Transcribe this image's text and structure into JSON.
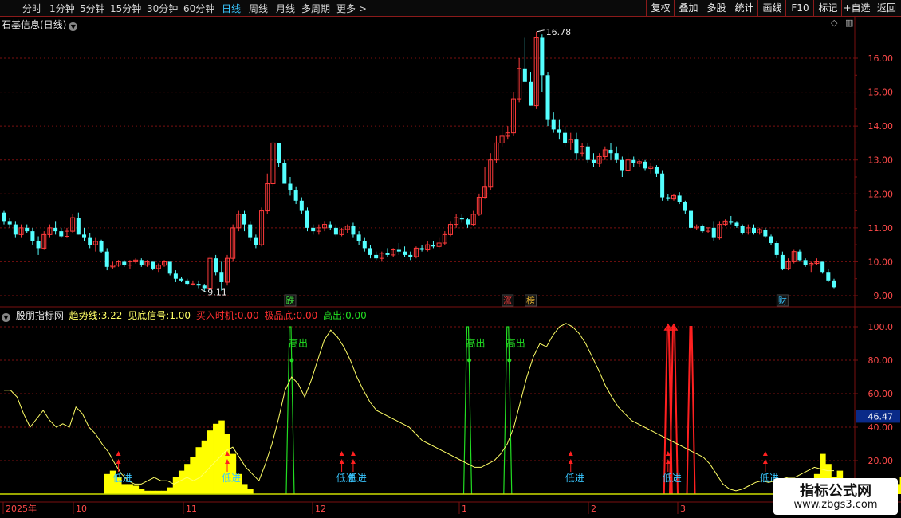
{
  "toolbar": {
    "periods": [
      "分时",
      "1分钟",
      "5分钟",
      "15分钟",
      "30分钟",
      "60分钟",
      "日线",
      "周线",
      "月线",
      "多周期",
      "更多 >"
    ],
    "active_period": "日线",
    "buttons": [
      "复权",
      "叠加",
      "多股",
      "统计",
      "画线",
      "F10",
      "标记",
      "+自选",
      "返回"
    ]
  },
  "main": {
    "title": "石基信息(日线)",
    "y_ticks": [
      "16.00",
      "15.00",
      "14.00",
      "13.00",
      "12.00",
      "11.00",
      "10.00",
      "9.00"
    ],
    "high_label": "16.78",
    "low_label": "9.11",
    "events": [
      {
        "text": "跌",
        "color": "#3cd63c"
      },
      {
        "text": "涨",
        "color": "#ff4040"
      },
      {
        "text": "榜",
        "color": "#e0b030"
      },
      {
        "text": "财",
        "color": "#39c6ff"
      }
    ]
  },
  "indicator": {
    "name": "股朋指标网",
    "trend_label": "趋势线:",
    "trend_value": "3.22",
    "bottom_label": "见底信号:",
    "bottom_value": "1.00",
    "buy_label": "买入时机:",
    "buy_value": "0.00",
    "extreme_label": "极品底:",
    "extreme_value": "0.00",
    "high_out_label": "高出:",
    "high_out_value": "0.00",
    "y_ticks": [
      "100.0",
      "80.00",
      "60.00",
      "40.00",
      "20.00"
    ],
    "current_value": "46.47",
    "low_in_text": "低进",
    "high_out_text": "高出"
  },
  "x_axis": {
    "labels": [
      "2025年",
      "10",
      "11",
      "12",
      "1",
      "2",
      "3"
    ]
  },
  "watermark": {
    "title": "指标公式网",
    "url": "www.zbgs3.com"
  },
  "colors": {
    "up": "#ff3b3b",
    "down": "#54ffff",
    "grid": "#7a1010",
    "trend": "#ffff66",
    "bars": "#ffff00",
    "green": "#22dd22",
    "red": "#ff2020",
    "signal": "#39c6ff"
  },
  "chart_data": {
    "type": "candlestick",
    "y_range": [
      8.8,
      16.9
    ],
    "candles": [
      [
        11.45,
        11.5,
        11.1,
        11.2
      ],
      [
        11.2,
        11.3,
        11.0,
        11.1
      ],
      [
        11.1,
        11.2,
        10.7,
        10.8
      ],
      [
        10.8,
        11.1,
        10.7,
        11.0
      ],
      [
        11.0,
        11.1,
        10.85,
        10.9
      ],
      [
        10.9,
        11.0,
        10.5,
        10.6
      ],
      [
        10.6,
        10.75,
        10.2,
        10.4
      ],
      [
        10.4,
        10.9,
        10.35,
        10.8
      ],
      [
        10.8,
        11.1,
        10.7,
        11.0
      ],
      [
        11.0,
        11.2,
        10.8,
        10.9
      ],
      [
        10.9,
        11.0,
        10.7,
        10.75
      ],
      [
        10.75,
        11.0,
        10.7,
        10.9
      ],
      [
        10.9,
        11.4,
        10.85,
        11.3
      ],
      [
        11.3,
        11.45,
        10.8,
        10.8
      ],
      [
        10.8,
        11.0,
        10.6,
        10.7
      ],
      [
        10.7,
        10.85,
        10.4,
        10.5
      ],
      [
        10.5,
        10.7,
        10.3,
        10.6
      ],
      [
        10.6,
        10.65,
        10.25,
        10.3
      ],
      [
        10.3,
        10.4,
        9.75,
        9.85
      ],
      [
        9.85,
        10.0,
        9.8,
        9.9
      ],
      [
        9.9,
        10.05,
        9.85,
        10.0
      ],
      [
        10.0,
        10.05,
        9.85,
        9.9
      ],
      [
        9.9,
        10.05,
        9.8,
        10.0
      ],
      [
        10.0,
        10.1,
        9.95,
        10.05
      ],
      [
        10.05,
        10.1,
        9.85,
        9.9
      ],
      [
        9.9,
        10.05,
        9.85,
        10.0
      ],
      [
        10.0,
        10.0,
        9.75,
        9.8
      ],
      [
        9.8,
        9.95,
        9.7,
        9.9
      ],
      [
        9.9,
        10.05,
        9.85,
        10.0
      ],
      [
        10.0,
        10.0,
        9.6,
        9.65
      ],
      [
        9.65,
        9.75,
        9.4,
        9.5
      ],
      [
        9.5,
        9.55,
        9.4,
        9.45
      ],
      [
        9.45,
        9.5,
        9.3,
        9.35
      ],
      [
        9.35,
        9.45,
        9.3,
        9.35
      ],
      [
        9.35,
        9.45,
        9.2,
        9.3
      ],
      [
        9.3,
        9.35,
        9.11,
        9.2
      ],
      [
        9.2,
        10.2,
        9.15,
        10.1
      ],
      [
        10.1,
        10.2,
        9.6,
        9.7
      ],
      [
        9.7,
        10.0,
        9.15,
        9.4
      ],
      [
        9.4,
        10.2,
        9.3,
        10.1
      ],
      [
        10.1,
        11.1,
        10.0,
        11.0
      ],
      [
        11.0,
        11.5,
        10.9,
        11.4
      ],
      [
        11.4,
        11.5,
        10.9,
        11.1
      ],
      [
        11.1,
        11.2,
        10.6,
        10.7
      ],
      [
        10.7,
        10.8,
        10.4,
        10.5
      ],
      [
        10.5,
        11.6,
        10.45,
        11.5
      ],
      [
        11.5,
        12.6,
        11.4,
        12.3
      ],
      [
        12.3,
        13.5,
        12.2,
        13.5
      ],
      [
        13.5,
        13.5,
        12.8,
        12.9
      ],
      [
        12.9,
        13.0,
        12.4,
        12.3
      ],
      [
        12.3,
        12.5,
        11.95,
        12.1
      ],
      [
        12.1,
        12.2,
        11.7,
        11.8
      ],
      [
        11.8,
        11.9,
        11.4,
        11.5
      ],
      [
        11.5,
        11.6,
        10.9,
        11.0
      ],
      [
        11.0,
        11.1,
        10.8,
        10.9
      ],
      [
        10.9,
        11.1,
        10.8,
        11.0
      ],
      [
        11.0,
        11.2,
        10.9,
        11.1
      ],
      [
        11.1,
        11.2,
        10.95,
        11.0
      ],
      [
        11.0,
        11.1,
        10.75,
        10.8
      ],
      [
        10.8,
        11.0,
        10.75,
        10.95
      ],
      [
        10.95,
        11.1,
        10.85,
        11.05
      ],
      [
        11.05,
        11.15,
        10.7,
        10.8
      ],
      [
        10.8,
        10.9,
        10.5,
        10.6
      ],
      [
        10.6,
        10.7,
        10.3,
        10.4
      ],
      [
        10.4,
        10.5,
        10.1,
        10.2
      ],
      [
        10.2,
        10.3,
        10.05,
        10.1
      ],
      [
        10.1,
        10.3,
        10.0,
        10.25
      ],
      [
        10.25,
        10.4,
        10.15,
        10.2
      ],
      [
        10.2,
        10.4,
        10.15,
        10.35
      ],
      [
        10.35,
        10.55,
        10.2,
        10.3
      ],
      [
        10.3,
        10.45,
        10.15,
        10.2
      ],
      [
        10.2,
        10.3,
        10.05,
        10.15
      ],
      [
        10.15,
        10.45,
        10.1,
        10.4
      ],
      [
        10.4,
        10.5,
        10.3,
        10.35
      ],
      [
        10.35,
        10.6,
        10.3,
        10.5
      ],
      [
        10.5,
        10.6,
        10.4,
        10.45
      ],
      [
        10.45,
        10.7,
        10.4,
        10.55
      ],
      [
        10.55,
        10.9,
        10.5,
        10.8
      ],
      [
        10.8,
        11.2,
        10.75,
        11.1
      ],
      [
        11.1,
        11.4,
        11.0,
        11.3
      ],
      [
        11.3,
        11.4,
        11.15,
        11.25
      ],
      [
        11.25,
        11.3,
        11.0,
        11.1
      ],
      [
        11.1,
        11.5,
        11.05,
        11.4
      ],
      [
        11.4,
        12.0,
        11.35,
        11.9
      ],
      [
        11.9,
        12.8,
        11.85,
        12.2
      ],
      [
        12.2,
        13.2,
        12.1,
        13.0
      ],
      [
        13.0,
        13.7,
        12.9,
        13.5
      ],
      [
        13.5,
        14.0,
        13.4,
        13.7
      ],
      [
        13.7,
        14.0,
        13.6,
        13.8
      ],
      [
        13.8,
        15.0,
        13.7,
        14.8
      ],
      [
        14.8,
        16.0,
        14.7,
        15.7
      ],
      [
        15.7,
        16.6,
        15.5,
        15.3
      ],
      [
        15.3,
        15.6,
        14.6,
        14.6
      ],
      [
        14.6,
        16.78,
        14.5,
        16.6
      ],
      [
        16.6,
        16.7,
        15.0,
        15.5
      ],
      [
        15.5,
        15.6,
        14.0,
        14.2
      ],
      [
        14.2,
        14.4,
        13.8,
        13.9
      ],
      [
        13.9,
        14.2,
        13.6,
        13.8
      ],
      [
        13.8,
        14.0,
        13.4,
        13.5
      ],
      [
        13.5,
        13.8,
        13.3,
        13.6
      ],
      [
        13.6,
        13.8,
        13.0,
        13.2
      ],
      [
        13.2,
        13.5,
        13.1,
        13.4
      ],
      [
        13.4,
        13.5,
        12.9,
        13.0
      ],
      [
        13.0,
        13.2,
        12.8,
        12.9
      ],
      [
        12.9,
        13.2,
        12.8,
        13.1
      ],
      [
        13.1,
        13.4,
        13.0,
        13.3
      ],
      [
        13.3,
        13.5,
        13.0,
        13.2
      ],
      [
        13.2,
        13.4,
        12.9,
        13.0
      ],
      [
        13.0,
        13.1,
        12.5,
        12.7
      ],
      [
        12.7,
        13.2,
        12.6,
        13.0
      ],
      [
        13.0,
        13.1,
        12.8,
        12.9
      ],
      [
        12.9,
        13.0,
        12.8,
        12.95
      ],
      [
        12.95,
        13.0,
        12.7,
        12.75
      ],
      [
        12.75,
        12.9,
        12.6,
        12.8
      ],
      [
        12.8,
        12.85,
        12.5,
        12.6
      ],
      [
        12.6,
        12.7,
        11.8,
        11.9
      ],
      [
        11.9,
        12.0,
        11.8,
        11.85
      ],
      [
        11.85,
        12.0,
        11.8,
        11.95
      ],
      [
        11.95,
        12.05,
        11.7,
        11.75
      ],
      [
        11.75,
        11.8,
        11.4,
        11.5
      ],
      [
        11.5,
        11.55,
        10.9,
        11.0
      ],
      [
        11.0,
        11.1,
        10.95,
        11.05
      ],
      [
        11.05,
        11.1,
        10.85,
        10.9
      ],
      [
        10.9,
        11.0,
        10.85,
        11.0
      ],
      [
        11.0,
        11.2,
        10.6,
        10.7
      ],
      [
        10.7,
        11.2,
        10.65,
        11.1
      ],
      [
        11.1,
        11.25,
        11.05,
        11.2
      ],
      [
        11.2,
        11.35,
        11.1,
        11.15
      ],
      [
        11.15,
        11.2,
        11.0,
        11.05
      ],
      [
        11.05,
        11.1,
        10.8,
        10.85
      ],
      [
        10.85,
        11.1,
        10.8,
        11.0
      ],
      [
        11.0,
        11.1,
        10.8,
        10.85
      ],
      [
        10.85,
        11.0,
        10.8,
        10.95
      ],
      [
        10.95,
        11.0,
        10.7,
        10.75
      ],
      [
        10.75,
        10.8,
        10.5,
        10.55
      ],
      [
        10.55,
        10.6,
        10.1,
        10.2
      ],
      [
        10.2,
        10.3,
        9.75,
        9.8
      ],
      [
        9.8,
        10.1,
        9.75,
        10.0
      ],
      [
        10.0,
        10.35,
        9.95,
        10.3
      ],
      [
        10.3,
        10.35,
        10.0,
        10.05
      ],
      [
        10.05,
        10.1,
        9.85,
        9.9
      ],
      [
        9.9,
        10.0,
        9.7,
        9.95
      ],
      [
        9.95,
        10.1,
        9.9,
        10.0
      ],
      [
        10.0,
        10.0,
        9.65,
        9.7
      ],
      [
        9.7,
        9.8,
        9.4,
        9.45
      ],
      [
        9.45,
        9.5,
        9.2,
        9.25
      ]
    ],
    "indicator_trend": [
      62,
      62,
      58,
      48,
      40,
      45,
      50,
      44,
      40,
      42,
      40,
      52,
      48,
      40,
      36,
      30,
      25,
      18,
      12,
      8,
      6,
      6,
      8,
      10,
      8,
      8,
      6,
      8,
      10,
      8,
      10,
      14,
      18,
      22,
      26,
      28,
      22,
      16,
      12,
      8,
      18,
      30,
      45,
      62,
      70,
      66,
      58,
      68,
      80,
      92,
      98,
      94,
      88,
      80,
      70,
      62,
      55,
      50,
      48,
      46,
      44,
      42,
      40,
      36,
      32,
      30,
      28,
      26,
      24,
      22,
      20,
      18,
      16,
      16,
      18,
      20,
      24,
      30,
      40,
      55,
      70,
      82,
      90,
      88,
      95,
      100,
      102,
      100,
      96,
      90,
      82,
      74,
      65,
      58,
      52,
      48,
      44,
      42,
      40,
      38,
      36,
      34,
      32,
      30,
      28,
      26,
      24,
      22,
      18,
      12,
      6,
      3,
      2,
      3,
      5,
      7,
      8,
      7,
      8,
      9,
      10,
      10,
      12,
      14,
      16,
      15,
      14,
      14
    ],
    "indicator_bars": [
      0,
      0,
      0,
      0,
      0,
      0,
      0,
      0,
      0,
      0,
      0,
      0,
      0,
      0,
      0,
      0,
      0,
      0,
      12,
      14,
      10,
      6,
      6,
      5,
      3,
      2,
      2,
      2,
      2,
      4,
      10,
      14,
      18,
      22,
      28,
      32,
      38,
      42,
      44,
      36,
      24,
      12,
      6,
      3,
      0,
      0,
      0,
      0,
      0,
      0,
      0,
      0,
      0,
      0,
      0,
      0,
      0,
      0,
      0,
      0,
      0,
      0,
      0,
      0,
      0,
      0,
      0,
      0,
      0,
      0,
      0,
      0,
      0,
      0,
      0,
      0,
      0,
      0,
      0,
      0,
      0,
      0,
      0,
      0,
      0,
      0,
      0,
      0,
      0,
      0,
      0,
      0,
      0,
      0,
      0,
      0,
      0,
      0,
      0,
      0,
      0,
      0,
      0,
      0,
      0,
      0,
      0,
      0,
      0,
      0,
      0,
      0,
      0,
      0,
      0,
      0,
      0,
      0,
      0,
      0,
      0,
      0,
      0,
      0,
      0,
      0,
      0,
      0,
      0,
      0,
      0,
      0,
      0,
      0,
      0,
      0,
      0,
      0,
      0,
      0,
      0,
      0,
      12,
      24,
      18,
      10,
      14,
      6,
      8,
      4,
      2,
      0,
      0,
      0,
      4,
      0,
      6,
      10,
      12,
      18,
      8,
      10,
      14,
      16,
      8,
      12,
      20,
      18
    ],
    "low_in_idx": [
      20,
      39,
      59,
      61,
      99,
      116,
      133
    ],
    "high_out_idx": [
      50,
      81,
      88
    ],
    "green_spikes": [
      50,
      81,
      88
    ],
    "red_spikes": [
      116,
      117,
      120
    ]
  }
}
